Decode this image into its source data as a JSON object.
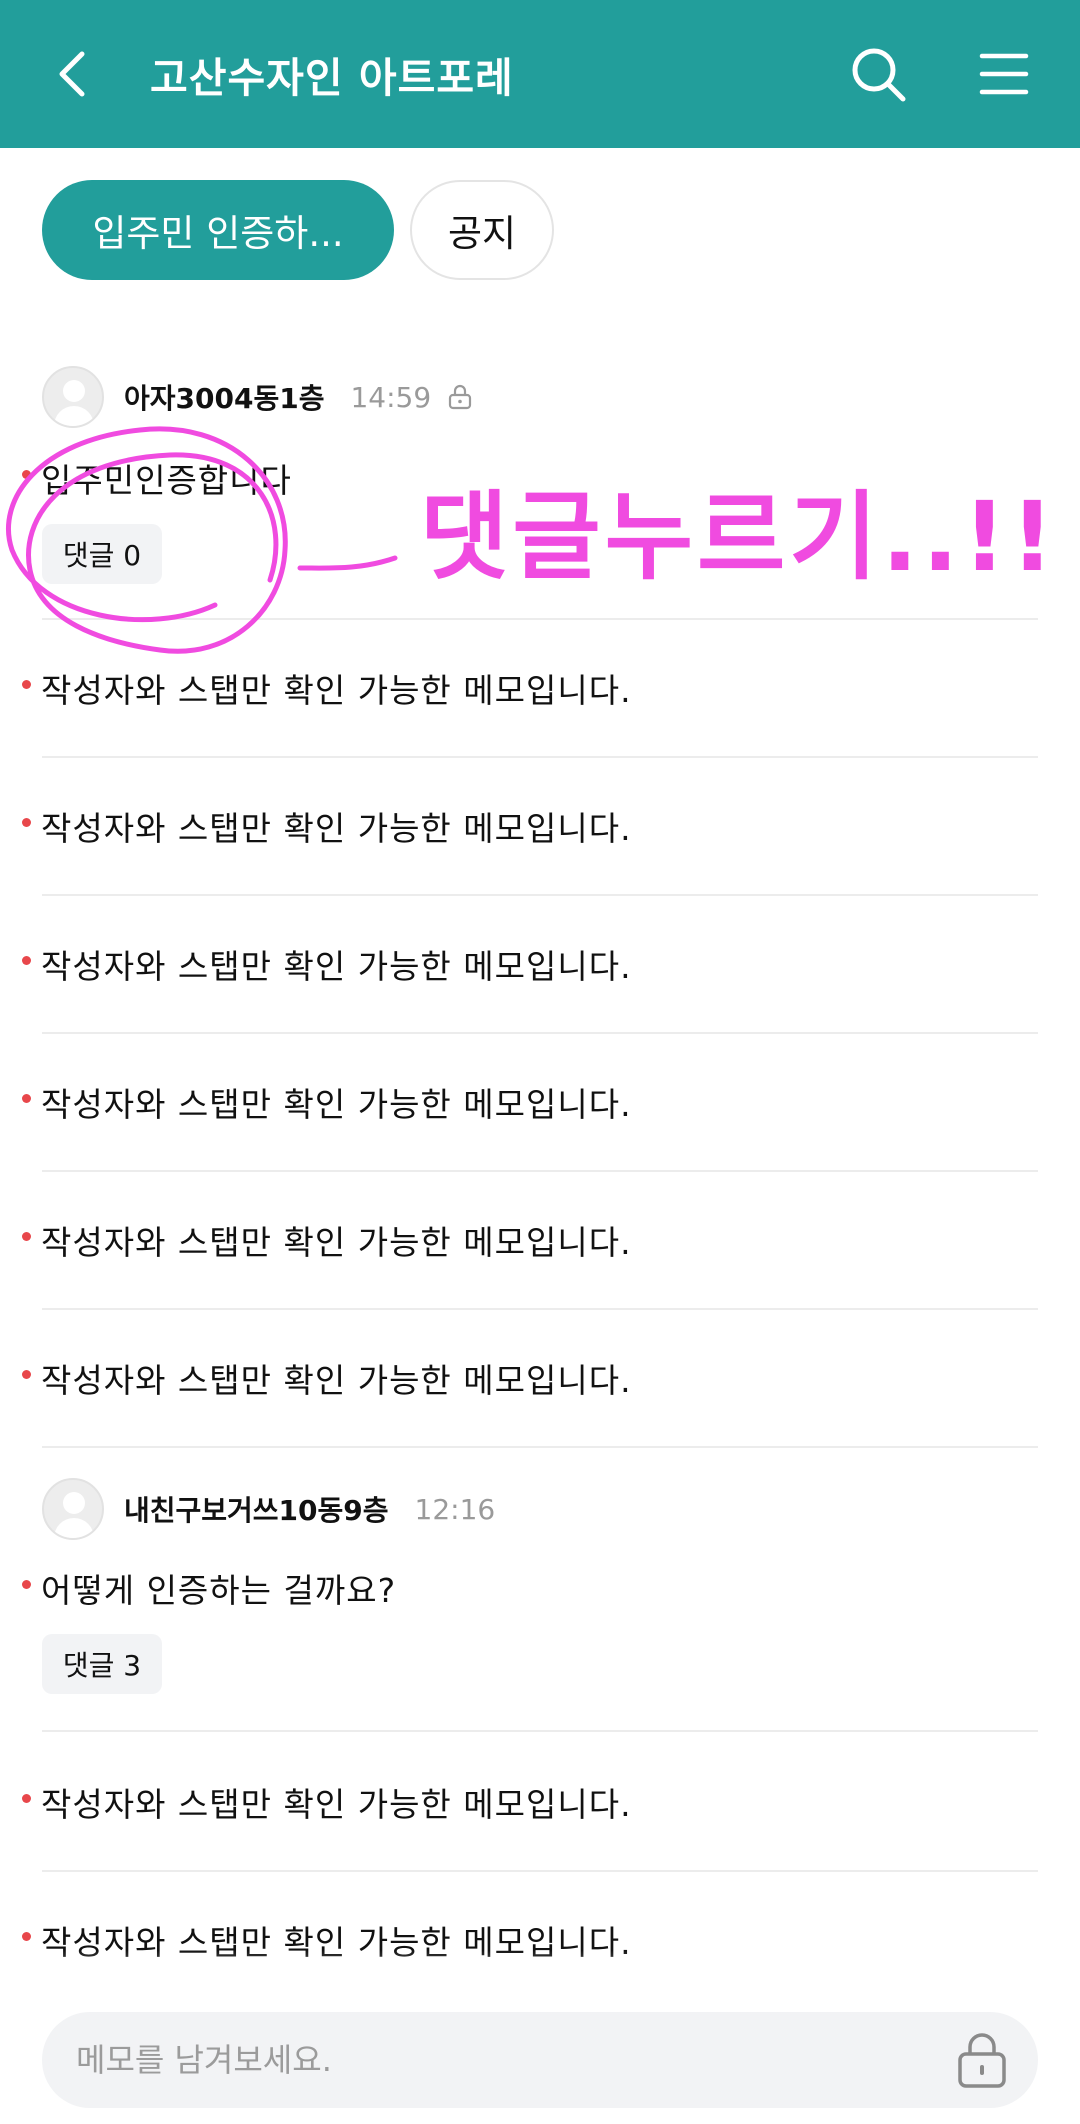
{
  "header": {
    "title": "고산수자인 아트포레",
    "bg_color": "#229e9b"
  },
  "chips": [
    {
      "label": "입주민 인증하...",
      "active": true
    },
    {
      "label": "공지",
      "active": false
    }
  ],
  "posts": [
    {
      "author": "아자3004동1층",
      "time": "14:59",
      "private": true,
      "text": "입주민인증합니다",
      "comment_label": "댓글 0"
    },
    {
      "author": "내친구보거쓰10동9층",
      "time": "12:16",
      "private": false,
      "text": "어떻게 인증하는 걸까요?",
      "comment_label": "댓글 3"
    }
  ],
  "private_memo": "작성자와 스탭만 확인 가능한 메모입니다.",
  "annotation": {
    "text": "댓글누르기..!!",
    "color": "#f04be0"
  },
  "memo_input": {
    "placeholder": "메모를 남겨보세요."
  },
  "icons": {
    "back": "chevron-left-icon",
    "search": "search-icon",
    "menu": "hamburger-menu-icon",
    "lock": "lock-icon"
  },
  "colors": {
    "accent": "#229e9b",
    "dot": "#e8474b",
    "annotation": "#f04be0"
  }
}
